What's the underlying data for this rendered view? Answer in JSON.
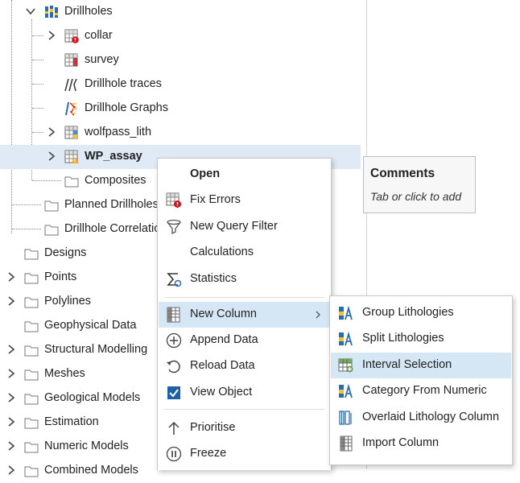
{
  "tree": {
    "items": [
      {
        "label": "Drillholes",
        "icon": "drillholes-icon"
      },
      {
        "label": "collar",
        "icon": "table-error-icon"
      },
      {
        "label": "survey",
        "icon": "table-icon"
      },
      {
        "label": "Drillhole traces",
        "icon": "traces-icon"
      },
      {
        "label": "Drillhole Graphs",
        "icon": "graphs-icon"
      },
      {
        "label": "wolfpass_lith",
        "icon": "table-icon"
      },
      {
        "label": "WP_assay",
        "icon": "table-warning-icon"
      },
      {
        "label": "Composites",
        "icon": "folder-icon"
      },
      {
        "label": "Planned Drillholes",
        "icon": "folder-icon"
      },
      {
        "label": "Drillhole Correlation",
        "icon": "folder-icon"
      },
      {
        "label": "Designs",
        "icon": "folder-icon"
      },
      {
        "label": "Points",
        "icon": "folder-icon"
      },
      {
        "label": "Polylines",
        "icon": "folder-icon"
      },
      {
        "label": "Geophysical Data",
        "icon": "folder-icon"
      },
      {
        "label": "Structural Modelling",
        "icon": "folder-icon"
      },
      {
        "label": "Meshes",
        "icon": "folder-icon"
      },
      {
        "label": "Geological Models",
        "icon": "folder-icon"
      },
      {
        "label": "Estimation",
        "icon": "folder-icon"
      },
      {
        "label": "Numeric Models",
        "icon": "folder-icon"
      },
      {
        "label": "Combined Models",
        "icon": "folder-icon"
      }
    ]
  },
  "context_menu": {
    "items": [
      {
        "label": "Open",
        "icon": ""
      },
      {
        "label": "Fix Errors",
        "icon": "fix-errors-icon"
      },
      {
        "label": "New Query Filter",
        "icon": "filter-icon"
      },
      {
        "label": "Calculations",
        "icon": ""
      },
      {
        "label": "Statistics",
        "icon": "statistics-icon"
      },
      {
        "label": "New Column",
        "icon": "new-column-icon"
      },
      {
        "label": "Append Data",
        "icon": "plus-circle-icon"
      },
      {
        "label": "Reload Data",
        "icon": "reload-icon"
      },
      {
        "label": "View Object",
        "icon": "checkbox-checked-icon"
      },
      {
        "label": "Prioritise",
        "icon": "arrow-up-icon"
      },
      {
        "label": "Freeze",
        "icon": "pause-icon"
      }
    ]
  },
  "submenu": {
    "items": [
      {
        "label": "Group Lithologies",
        "icon": "group-lith-icon"
      },
      {
        "label": "Split Lithologies",
        "icon": "split-lith-icon"
      },
      {
        "label": "Interval Selection",
        "icon": "interval-selection-icon"
      },
      {
        "label": "Category From Numeric",
        "icon": "category-numeric-icon"
      },
      {
        "label": "Overlaid Lithology Column",
        "icon": "overlaid-lith-icon"
      },
      {
        "label": "Import Column",
        "icon": "import-column-icon"
      }
    ]
  },
  "comments": {
    "title": "Comments",
    "hint": "Tab or click to add"
  },
  "colors": {
    "selection": "#dfeaf6",
    "menu_highlight": "#d5e7f5",
    "error": "#d0121b",
    "warning": "#f5a623",
    "icon_blue": "#2a6bb3"
  }
}
